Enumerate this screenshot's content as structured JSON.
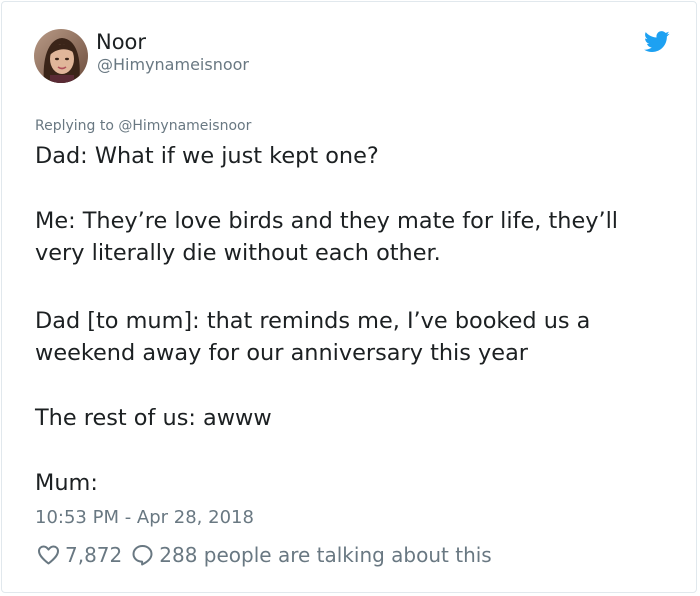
{
  "author": {
    "display_name": "Noor",
    "handle": "@Himynameisnoor",
    "avatar_icon": "profile-photo"
  },
  "brand": {
    "icon": "twitter-bird-icon",
    "color": "#1da1f2"
  },
  "tweet": {
    "replying_to": "Replying to @Himynameisnoor",
    "lines": [
      "Dad: What if we just kept one?",
      "Me: They’re love birds and they mate for life, they’ll",
      "very literally die without each other.",
      "Dad [to mum]: that reminds me, I’ve booked us a",
      "weekend away for our anniversary this year",
      "The rest of us: awww",
      "Mum:"
    ],
    "timestamp": "10:53 PM - Apr 28, 2018"
  },
  "engagement": {
    "likes": "7,872",
    "talking": "288 people are talking about this"
  },
  "colors": {
    "text": "#1c2022",
    "secondary": "#697882",
    "border": "#e1e8ed"
  }
}
